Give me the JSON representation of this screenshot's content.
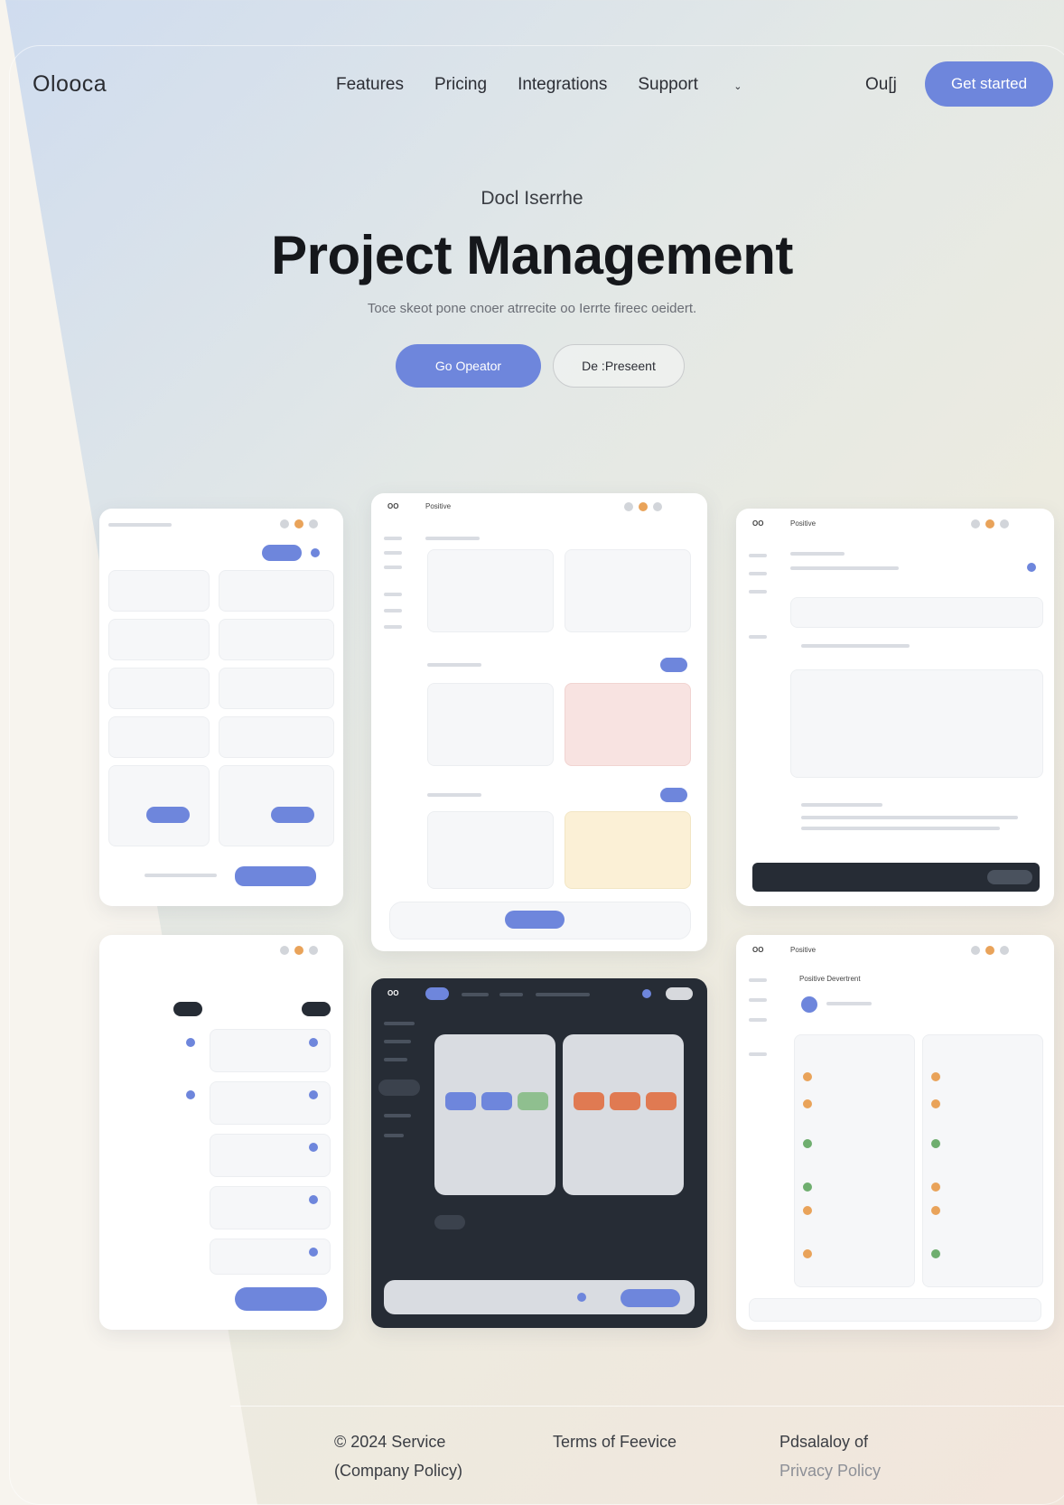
{
  "nav": {
    "logo": "Olooca",
    "links": [
      "Features",
      "Pricing",
      "Integrations",
      "Support"
    ],
    "support_chevron": "chevron-down-icon",
    "login": "Ou[j",
    "cta": "Get started"
  },
  "hero": {
    "eyebrow": "Docl Iserrhe",
    "title": "Project Management",
    "subtitle": "Toce skeot pone cnoer atrrecite oo Ierrte fireec oeidert.",
    "primary_button": "Go Opeator",
    "secondary_button": "De :Preseent"
  },
  "cards": {
    "c2_title": "Positive",
    "c3_title": "Positive",
    "c6_title": "Positive",
    "c6_heading": "Positive Devertrent"
  },
  "footer": {
    "col1_line1": "© 2024 Service",
    "col1_line2": "(Company Policy)",
    "col2": "Terms of Feevice",
    "col3_line1": "Pdsalaloy of",
    "col3_line2": "Privacy Policy"
  },
  "colors": {
    "accent": "#6e86dc",
    "dark_card": "#262c35"
  }
}
